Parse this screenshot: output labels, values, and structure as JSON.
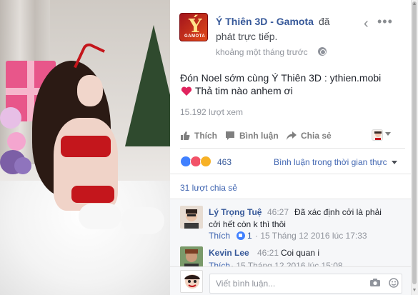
{
  "post": {
    "page_name": "Ý Thiên 3D - Gamota",
    "action_line1": "đã",
    "action_line2": "phát trực tiếp.",
    "time": "khoảng một tháng trước",
    "logo_initial": "Ý",
    "logo_brand": "GAMOTA",
    "text_line1": "Đón Noel sớm cùng Ý Thiên 3D : ythien.mobi",
    "text_line2": "Thả tim nào anhem ơi",
    "views": "15.192 lượt xem"
  },
  "actions": {
    "like": "Thích",
    "comment": "Bình luận",
    "share": "Chia sẻ"
  },
  "reactions": {
    "count": "463",
    "colors": [
      "#4080ff",
      "#f25268",
      "#f7b125"
    ],
    "live_comments_label": "Bình luận trong thời gian thực"
  },
  "shares": {
    "label": "31 lượt chia sẻ"
  },
  "comments": [
    {
      "author": "Lý Trọng Tuệ",
      "time": "46:27",
      "text_line1": "Đã xác định cởi là phải",
      "text_line2": "cởi hết còn k thì thôi",
      "like_label": "Thích",
      "like_count": "1",
      "meta": "· 15 Tháng 12 2016 lúc 17:33"
    },
    {
      "author": "Kevin Lee",
      "time": "46:21",
      "text_line1": "Coi quan i",
      "like_label": "Thích",
      "meta": "· 15 Tháng 12 2016 lúc 15:08"
    }
  ],
  "composer": {
    "placeholder": "Viết bình luận..."
  },
  "icons": {
    "back": "chevron-left-icon",
    "more": "more-horizontal-icon",
    "globe": "globe-icon",
    "heart": "heart-icon",
    "like": "thumbs-up-icon",
    "comment": "comment-icon",
    "share": "share-arrow-icon",
    "camera": "camera-icon",
    "emoji": "emoji-icon"
  }
}
